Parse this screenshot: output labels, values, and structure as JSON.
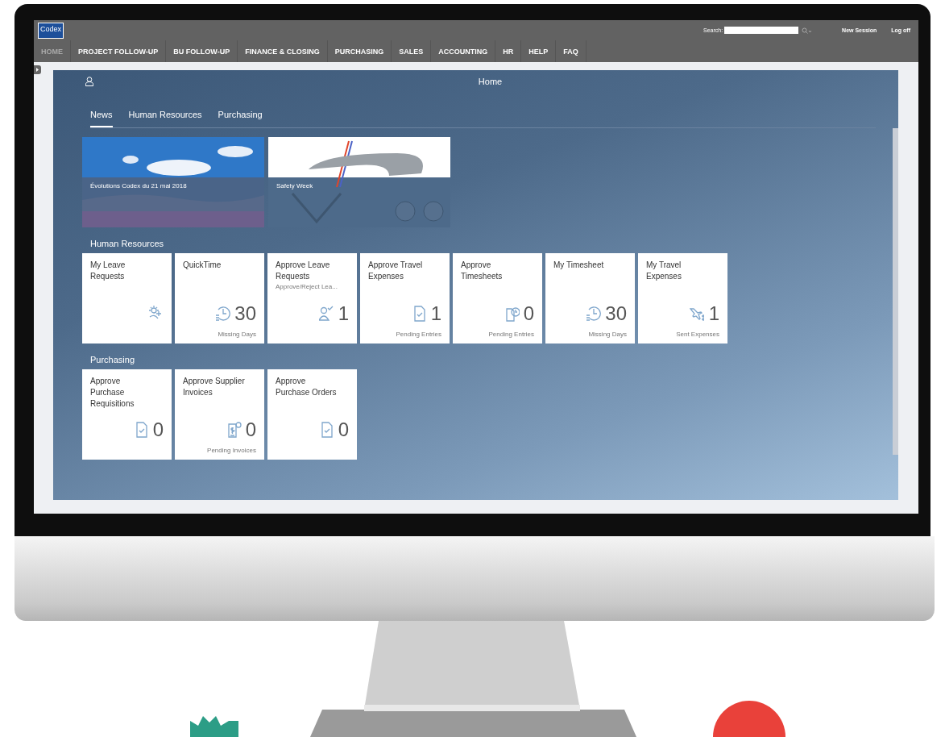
{
  "screen": {
    "logo": "Codex",
    "search": {
      "label": "Search:"
    },
    "header_links": [
      "New Session",
      "Log off"
    ],
    "nav": [
      {
        "label": "HOME",
        "selected": true
      },
      {
        "label": "PROJECT FOLLOW-UP",
        "selected": false
      },
      {
        "label": "BU FOLLOW-UP",
        "selected": false
      },
      {
        "label": "FINANCE & CLOSING",
        "selected": false
      },
      {
        "label": "PURCHASING",
        "selected": false
      },
      {
        "label": "SALES",
        "selected": false
      },
      {
        "label": "ACCOUNTING",
        "selected": false
      },
      {
        "label": "HR",
        "selected": false
      },
      {
        "label": "HELP",
        "selected": false
      },
      {
        "label": "FAQ",
        "selected": false
      }
    ],
    "shell": {
      "title": "Home"
    },
    "tabs": [
      {
        "label": "News",
        "selected": true
      },
      {
        "label": "Human Resources",
        "selected": false
      },
      {
        "label": "Purchasing",
        "selected": false
      }
    ],
    "news": [
      {
        "title": "Évolutions Codex du 21 mai 2018",
        "kind": "landscape"
      },
      {
        "title": "Safety Week",
        "kind": "poster"
      }
    ],
    "groups": [
      {
        "title": "Human Resources",
        "tiles": [
          {
            "title": "My Leave Requests",
            "kind": "sun"
          },
          {
            "title": "QuickTime",
            "kind": "clock",
            "number": "30",
            "footer": "Missing Days"
          },
          {
            "title": "Approve Leave Requests",
            "subtitle": "Approve/Reject Lea...",
            "kind": "approve",
            "number": "1"
          },
          {
            "title": "Approve Travel Expenses",
            "kind": "document",
            "number": "1",
            "footer": "Pending Entries"
          },
          {
            "title": "Approve Timesheets",
            "kind": "timesheet",
            "number": "0",
            "footer": "Pending Entries"
          },
          {
            "title": "My Timesheet",
            "kind": "clock",
            "number": "30",
            "footer": "Missing Days"
          },
          {
            "title": "My Travel Expenses",
            "kind": "travel",
            "number": "1",
            "footer": "Sent Expenses"
          }
        ]
      },
      {
        "title": "Purchasing",
        "tiles": [
          {
            "title": "Approve Purchase Requisitions",
            "kind": "document",
            "number": "0"
          },
          {
            "title": "Approve Supplier Invoices",
            "kind": "invoice",
            "number": "0",
            "footer": "Pending Invoices"
          },
          {
            "title": "Approve Purchase Orders",
            "kind": "document",
            "number": "0"
          }
        ]
      }
    ]
  }
}
